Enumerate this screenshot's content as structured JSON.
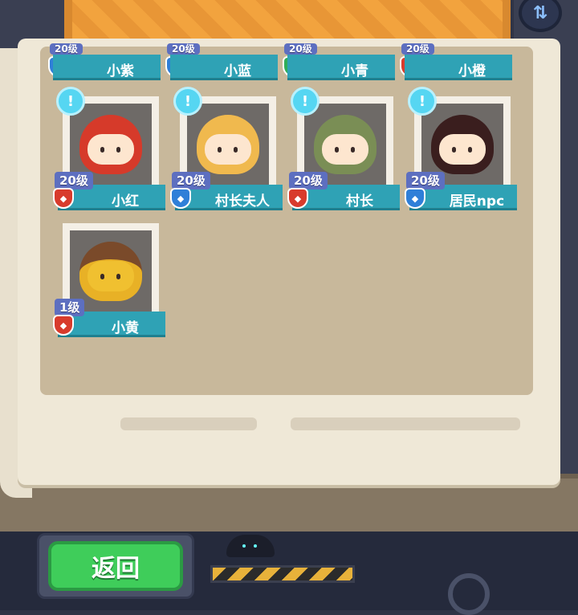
{
  "top_row": [
    {
      "name": "小紫",
      "level": "20级",
      "shield_color": "blue"
    },
    {
      "name": "小蓝",
      "level": "20级",
      "shield_color": "blue"
    },
    {
      "name": "小青",
      "level": "20级",
      "shield_color": "green"
    },
    {
      "name": "小橙",
      "level": "20级",
      "shield_color": "red"
    }
  ],
  "characters": [
    {
      "name": "小红",
      "level": "20级",
      "shield_color": "red",
      "hair": "#d63a2a",
      "icon": "strawberry-hat"
    },
    {
      "name": "村长夫人",
      "level": "20级",
      "shield_color": "blue",
      "hair": "#f0b94e",
      "icon": "bonnet"
    },
    {
      "name": "村长",
      "level": "20级",
      "shield_color": "red",
      "hair": "#7a8e55",
      "icon": "green-hat"
    },
    {
      "name": "居民npc",
      "level": "20级",
      "shield_color": "blue",
      "hair": "#3a1e1e",
      "icon": "headband"
    },
    {
      "name": "小黄",
      "level": "1级",
      "shield_color": "red",
      "hair": "#7a4a2a",
      "icon": "acorn-hat"
    }
  ],
  "back_button": {
    "label": "返回"
  },
  "colors": {
    "accent_green": "#3fcd5a",
    "tag_teal": "#2fa2b5",
    "level_blue": "#5d6fc0"
  }
}
